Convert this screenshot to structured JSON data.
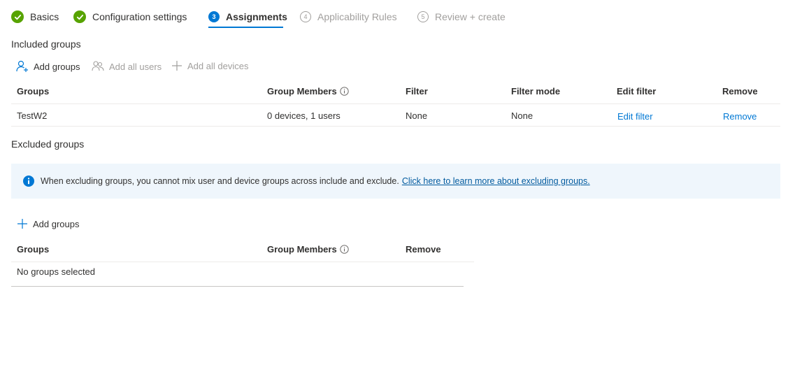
{
  "wizard": {
    "steps": [
      {
        "label": "Basics",
        "state": "done"
      },
      {
        "label": "Configuration settings",
        "state": "done"
      },
      {
        "label": "Assignments",
        "number": "3",
        "state": "active"
      },
      {
        "label": "Applicability Rules",
        "number": "4",
        "state": "pending"
      },
      {
        "label": "Review + create",
        "number": "5",
        "state": "pending"
      }
    ]
  },
  "included": {
    "title": "Included groups",
    "commands": {
      "add_groups": "Add groups",
      "add_all_users": "Add all users",
      "add_all_devices": "Add all devices"
    },
    "columns": [
      "Groups",
      "Group Members",
      "Filter",
      "Filter mode",
      "Edit filter",
      "Remove"
    ],
    "rows": [
      {
        "group": "TestW2",
        "members": "0 devices, 1 users",
        "filter": "None",
        "filter_mode": "None",
        "edit_filter": "Edit filter",
        "remove": "Remove"
      }
    ]
  },
  "excluded": {
    "title": "Excluded groups",
    "info_message": "When excluding groups, you cannot mix user and device groups across include and exclude.",
    "info_link": "Click here to learn more about excluding groups.",
    "commands": {
      "add_groups": "Add groups"
    },
    "columns": [
      "Groups",
      "Group Members",
      "Remove"
    ],
    "empty_text": "No groups selected"
  },
  "colors": {
    "accent": "#0078d4",
    "success": "#57a300",
    "info_bg": "#eff6fc",
    "disabled": "#a19f9d"
  },
  "icons": {
    "step_done": "checkmark-circle-icon",
    "add_groups": "add-person-icon",
    "add_all_users": "people-icon",
    "add_all_devices": "plus-icon",
    "info": "info-icon"
  }
}
